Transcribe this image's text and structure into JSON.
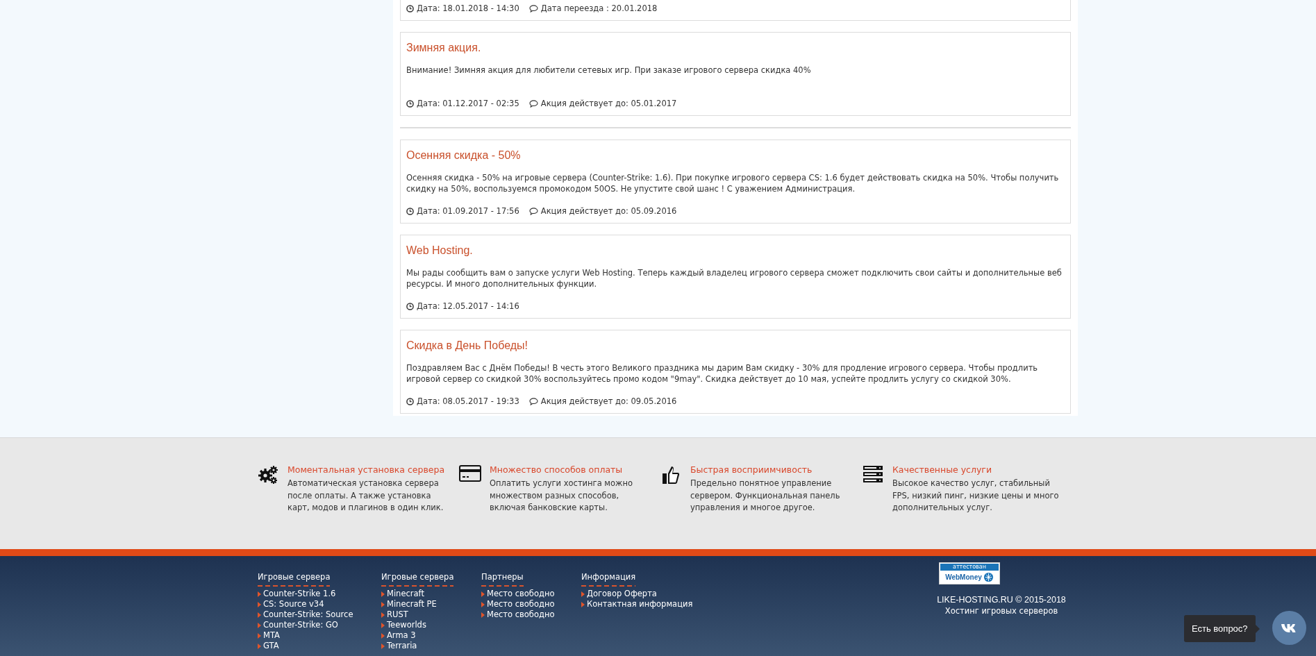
{
  "news_groups": [
    [
      {
        "date": "Дата: 18.01.2018 - 14:30",
        "note": "Дата переезда : 20.01.2018"
      },
      {
        "title": "Зимняя акция.",
        "body": "Внимание! Зимняя акция для любители сетевых игр. При заказе игрового сервера скидка 40%",
        "date": "Дата: 01.12.2017 - 02:35",
        "note": "Акция действует до: 05.01.2017"
      }
    ],
    [
      {
        "title": "Осенняя скидка - 50%",
        "body": "Осенняя скидка - 50% на игровые сервера (Counter-Strike: 1.6). При покупке игрового сервера CS: 1.6 будет действовать скидка на 50%. Чтобы получить скидку на 50%, воспользуемся промокодом 50OS. Не упустите свой шанс ! С уважением Администрация.",
        "date": "Дата: 01.09.2017 - 17:56",
        "note": "Акция действует до: 05.09.2016"
      },
      {
        "title": "Web Hosting.",
        "body": "Мы рады сообщить вам о запуске услуги Web Hosting. Теперь каждый владелец игрового сервера сможет подключить свои сайты и дополнительные веб ресурсы. И много дополнительных функции.",
        "date": "Дата: 12.05.2017 - 14:16"
      },
      {
        "title": "Скидка в День Победы!",
        "body": "Поздравляем Вас с Днём Победы! В честь этого Великого праздника мы дарим Вам скидку - 30% для продление игрового сервера. Чтобы продлить игровой сервер со скидкой 30% воспользуйтесь промо кодом \"9may\". Скидка действует до 10 мая, успейте продлить услугу со скидкой 30%.",
        "date": "Дата: 08.05.2017 - 19:33",
        "note": "Акция действует до: 09.05.2016"
      }
    ]
  ],
  "features": [
    {
      "title": "Моментальная установка сервера",
      "text": "Автоматическая установка сервера после оплаты. А также установка карт, модов и плагинов в один клик."
    },
    {
      "title": "Множество способов оплаты",
      "text": "Оплатить услуги хостинга можно множеством разных способов, включая банковские карты."
    },
    {
      "title": "Быстрая восприимчивость",
      "text": "Предельно понятное управление сервером. Функциональная панель управления и многое другое."
    },
    {
      "title": "Качественные услуги",
      "text": "Высокое качество услуг, стабильный FPS, низкий пинг, низкие цены и много дополнительных услуг."
    }
  ],
  "footer": {
    "columns": [
      {
        "heading": "Игровые сервера",
        "links": [
          "Counter-Strike 1.6",
          "CS: Source v34",
          "Counter-Strike: Source",
          "Counter-Strike: GO",
          "MTA",
          "GTA"
        ]
      },
      {
        "heading": "Игровые сервера",
        "links": [
          "Minecraft",
          "Minecraft PE",
          "RUST",
          "Teeworlds",
          "Arma 3",
          "Terraria"
        ]
      },
      {
        "heading": "Партнеры",
        "links": [
          "Место свободно",
          "Место свободно",
          "Место свободно"
        ]
      },
      {
        "heading": "Информация",
        "links": [
          "Договор Оферта",
          "Контактная информация"
        ]
      }
    ],
    "badge": {
      "top": "аттестован",
      "brand": "WebMoney"
    },
    "copyright": "LIKE-HOSTING.RU © 2015-2018",
    "tagline": "Хостинг игровых серверов"
  },
  "chat": {
    "tooltip": "Есть вопрос?"
  }
}
